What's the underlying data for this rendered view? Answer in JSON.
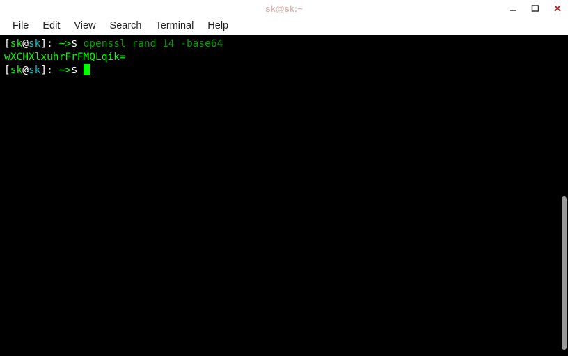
{
  "titlebar": {
    "title": "sk@sk:~"
  },
  "menu": {
    "items": [
      "File",
      "Edit",
      "View",
      "Search",
      "Terminal",
      "Help"
    ]
  },
  "terminal": {
    "prompt": {
      "lbracket": "[",
      "user": "sk",
      "at": "@",
      "host": "sk",
      "rbracket": "]",
      "colon": ":",
      "path_prefix": " ~>",
      "dollar": "$ "
    },
    "command": "openssl rand 14 -base64",
    "output": "wXCHXlxuhrFrFMQLqik="
  }
}
